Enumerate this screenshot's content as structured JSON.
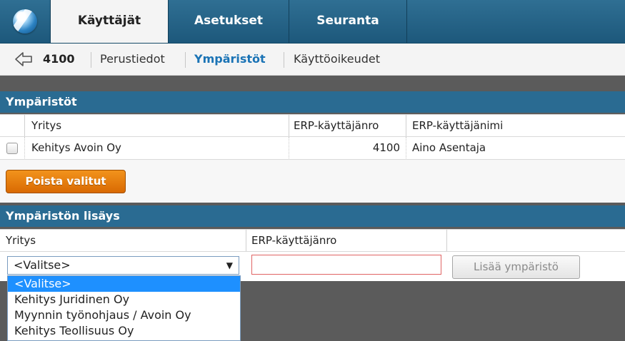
{
  "nav": {
    "tabs": [
      {
        "label": "Käyttäjät"
      },
      {
        "label": "Asetukset"
      },
      {
        "label": "Seuranta"
      }
    ]
  },
  "breadcrumb": {
    "id": "4100",
    "items": [
      {
        "label": "Perustiedot"
      },
      {
        "label": "Ympäristöt"
      },
      {
        "label": "Käyttöoikeudet"
      }
    ]
  },
  "environments": {
    "title": "Ympäristöt",
    "columns": [
      "Yritys",
      "ERP-käyttäjänro",
      "ERP-käyttäjänimi"
    ],
    "rows": [
      {
        "company": "Kehitys Avoin Oy",
        "erp_number": "4100",
        "erp_name": "Aino Asentaja",
        "checked": false
      }
    ],
    "delete_button": "Poista valitut"
  },
  "add_environment": {
    "title": "Ympäristön lisäys",
    "columns": [
      "Yritys",
      "ERP-käyttäjänro"
    ],
    "company_select": {
      "value": "<Valitse>",
      "options": [
        "<Valitse>",
        "Kehitys Juridinen Oy",
        "Myynnin työnohjaus / Avoin Oy",
        "Kehitys Teollisuus Oy"
      ]
    },
    "erp_number_value": "",
    "add_button": "Lisää ympäristö"
  },
  "icons": {
    "logo": "app-logo-icon",
    "back": "back-arrow-icon",
    "select_arrow": "triangle-down-icon"
  },
  "colors": {
    "nav": "#1d587b",
    "header": "#2a6b92",
    "active_link": "#1a73b5",
    "orange_button": "#e57c0a",
    "select_highlight": "#1e90ff",
    "invalid_border": "#e06464"
  }
}
